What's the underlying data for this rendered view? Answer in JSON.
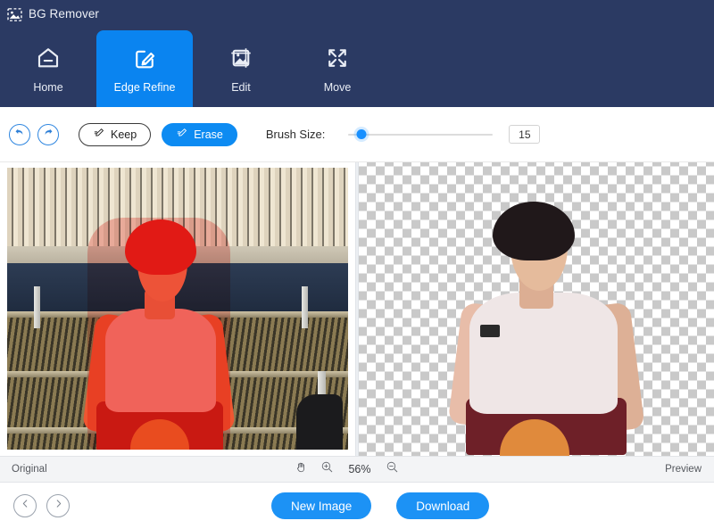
{
  "app": {
    "title": "BG Remover",
    "logo_icon": "image-dashed-icon",
    "header_bg": "#2b3a63",
    "accent": "#0a84f0"
  },
  "nav": {
    "items": [
      {
        "label": "Home",
        "icon": "home-minus-icon",
        "active": false
      },
      {
        "label": "Edge Refine",
        "icon": "pencil-square-icon",
        "active": true
      },
      {
        "label": "Edit",
        "icon": "image-crop-icon",
        "active": false
      },
      {
        "label": "Move",
        "icon": "move-arrows-icon",
        "active": false
      }
    ]
  },
  "toolbar": {
    "undo_icon": "undo-arrow-icon",
    "redo_icon": "redo-arrow-icon",
    "keep_label": "Keep",
    "keep_icon": "brush-keep-icon",
    "erase_label": "Erase",
    "erase_icon": "brush-erase-icon",
    "brush_size_label": "Brush Size:",
    "brush_size_value": "15",
    "brush_slider_percent": 9
  },
  "canvas": {
    "left_pane_name": "original-image",
    "right_pane_name": "preview-image",
    "subject_description": "young man in white tank top holding a basketball"
  },
  "statusbar": {
    "left_label": "Original",
    "right_label": "Preview",
    "hand_icon": "hand-pan-icon",
    "zoom_in_icon": "zoom-in-icon",
    "zoom_out_icon": "zoom-out-icon",
    "zoom_value": "56%"
  },
  "footer": {
    "prev_icon": "chevron-left-icon",
    "next_icon": "chevron-right-icon",
    "new_image_label": "New Image",
    "download_label": "Download"
  }
}
